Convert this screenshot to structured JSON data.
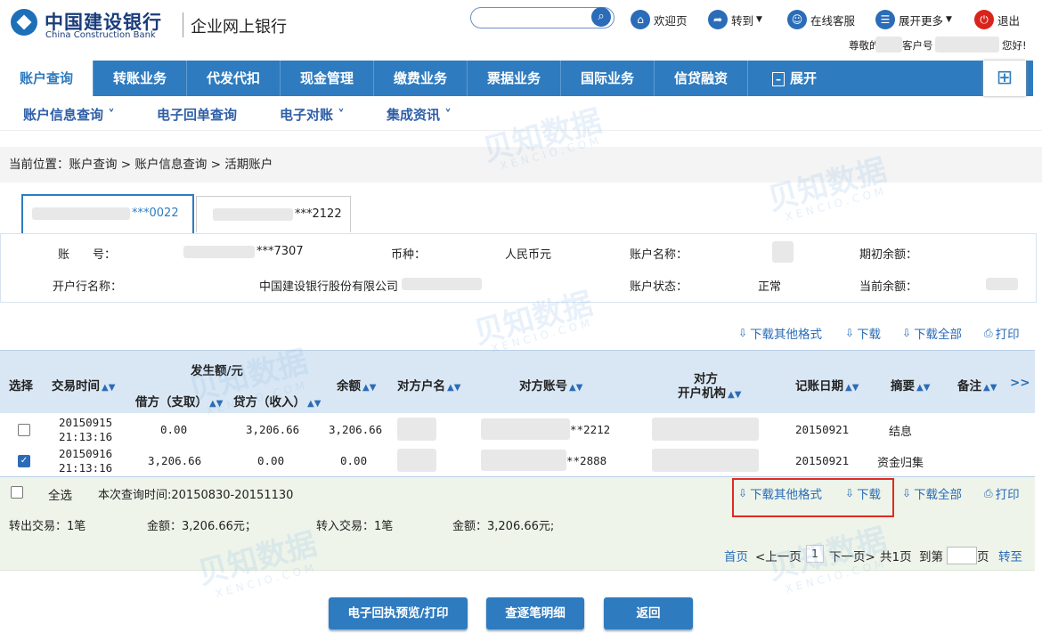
{
  "header": {
    "logo_cn": "中国建设银行",
    "logo_en": "China Construction Bank",
    "subtitle": "企业网上银行",
    "search_icon": "search-icon",
    "links": [
      {
        "label": "欢迎页",
        "icon": "home-icon"
      },
      {
        "label": "转到",
        "icon": "share-arrow-icon"
      },
      {
        "label": "在线客服",
        "icon": "headset-icon"
      },
      {
        "label": "展开更多",
        "icon": "list-icon"
      },
      {
        "label": "退出",
        "icon": "power-icon"
      }
    ],
    "greeting_prefix": "尊敬的",
    "greeting_mid": "客户号",
    "greeting_suffix": "您好!"
  },
  "nav": {
    "items": [
      "账户查询",
      "转账业务",
      "代发代扣",
      "现金管理",
      "缴费业务",
      "票据业务",
      "国际业务",
      "信贷融资",
      "展开"
    ],
    "active_index": 0
  },
  "subnav": {
    "items": [
      "账户信息查询 ˅",
      "电子回单查询",
      "电子对账 ˅",
      "集成资讯 ˅"
    ]
  },
  "breadcrumb": "当前位置：账户查询 > 账户信息查询 > 活期账户",
  "tabs": [
    {
      "label": "***0022"
    },
    {
      "label": "***2122"
    }
  ],
  "account_info": {
    "account_no_label": "账　　号：",
    "account_no": "***7307",
    "currency_label": "币种：",
    "currency": "人民币元",
    "account_name_label": "账户名称：",
    "opening_balance_label": "期初余额：",
    "bank_name_label": "开户行名称：",
    "bank_name": "中国建设银行股份有限公司",
    "status_label": "账户状态：",
    "status": "正常",
    "current_balance_label": "当前余额："
  },
  "actions": {
    "download_other": "下载其他格式",
    "download": "下载",
    "download_all": "下载全部",
    "print": "打印"
  },
  "grid": {
    "headers": {
      "select": "选择",
      "time": "交易时间",
      "amount_group": "发生额/元",
      "debit": "借方（支取）",
      "credit": "贷方（收入）",
      "balance": "余额",
      "counter_name": "对方户名",
      "counter_account": "对方账号",
      "counter_bank_l1": "对方",
      "counter_bank_l2": "开户机构",
      "booking_date": "记账日期",
      "summary": "摘要",
      "remark": "备注",
      "more": ">>"
    },
    "rows": [
      {
        "checked": false,
        "date": "20150915",
        "time": "21:13:16",
        "debit": "0.00",
        "credit": "3,206.66",
        "balance": "3,206.66",
        "counter_account": "**2212",
        "booking_date": "20150921",
        "summary": "结息"
      },
      {
        "checked": true,
        "date": "20150916",
        "time": "21:13:16",
        "debit": "3,206.66",
        "credit": "0.00",
        "balance": "0.00",
        "counter_account": "**2888",
        "booking_date": "20150921",
        "summary": "资金归集"
      }
    ]
  },
  "footer": {
    "select_all": "全选",
    "query_period": "本次查询时间:20150830-20151130",
    "out_tx": "转出交易：1笔",
    "out_amount": "金额：3,206.66元；",
    "in_tx": "转入交易：1笔",
    "in_amount": "金额：3,206.66元;"
  },
  "pagination": {
    "first": "首页",
    "prev": "<上一页",
    "current": "1",
    "next": "下一页>",
    "total": "共1页",
    "goto_prefix": "到第",
    "goto_suffix": "页",
    "go": "转至"
  },
  "buttons": {
    "preview_print": "电子回执预览/打印",
    "detail": "查逐笔明细",
    "back": "返回"
  },
  "watermark": {
    "cn": "贝知数据",
    "en": "XENCIO.COM"
  },
  "colors": {
    "primary": "#2f7bbf",
    "highlight": "#e02b1f",
    "link": "#2b6cb8"
  }
}
